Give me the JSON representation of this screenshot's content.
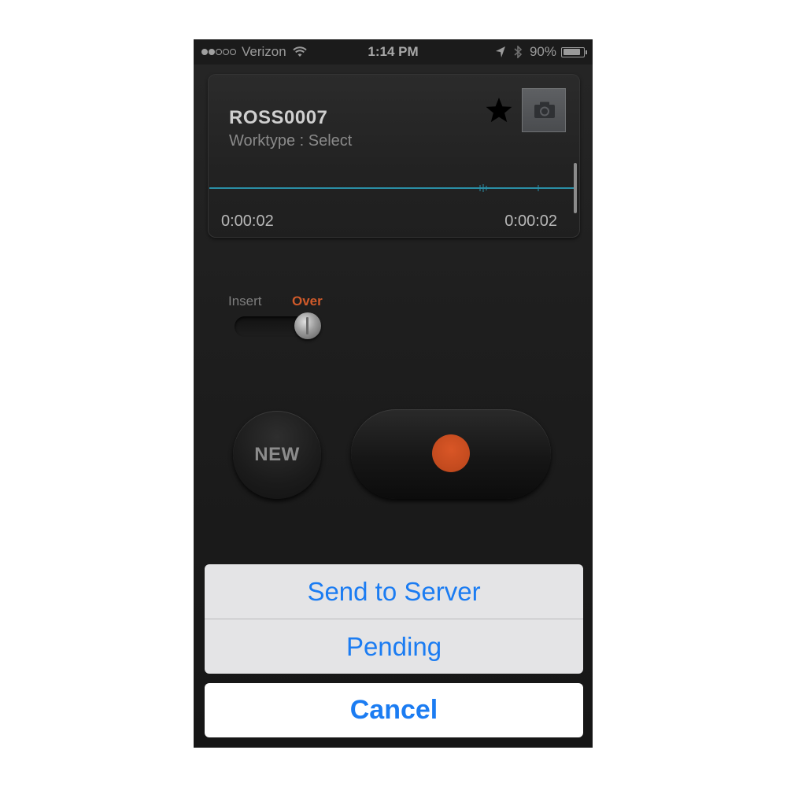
{
  "status_bar": {
    "carrier": "Verizon",
    "signal_bars_filled": 2,
    "signal_bars_total": 5,
    "time": "1:14 PM",
    "battery_percent": "90%",
    "battery_level": 0.9,
    "icons": [
      "wifi-icon",
      "location-arrow-icon",
      "bluetooth-icon",
      "battery-icon"
    ]
  },
  "recording": {
    "title": "ROSS0007",
    "worktype": "Worktype : Select",
    "elapsed": "0:00:02",
    "duration": "0:00:02",
    "icons": [
      "star-icon",
      "camera-icon"
    ]
  },
  "mode_toggle": {
    "insert_label": "Insert",
    "over_label": "Over",
    "selected": "Over"
  },
  "controls": {
    "new_label": "NEW",
    "record_icon": "record-dot-icon"
  },
  "action_sheet": {
    "options": [
      "Send to Server",
      "Pending"
    ],
    "cancel_label": "Cancel"
  },
  "colors": {
    "accent_blue": "#1b7cf2",
    "record_red": "#c94e20",
    "over_orange": "#d05a2a",
    "waveform_teal": "#2a8fa6"
  }
}
